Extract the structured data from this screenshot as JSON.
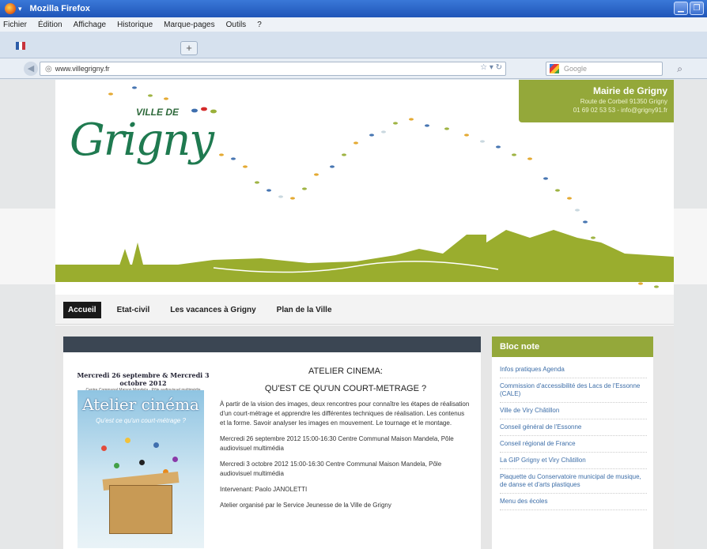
{
  "window": {
    "title": "Mozilla Firefox",
    "menu": [
      "Fichier",
      "Édition",
      "Affichage",
      "Historique",
      "Marque-pages",
      "Outils",
      "?"
    ],
    "tab_label": "",
    "new_tab_label": "+",
    "url": "www.villegrigny.fr",
    "search_placeholder": "Google",
    "colors": {
      "titlebar": "#1f55b8",
      "accent": "#94a83a"
    }
  },
  "site": {
    "logo": {
      "prefix": "VILLE DE",
      "name": "Grigny"
    },
    "mairie": {
      "title": "Mairie de Grigny",
      "line1": "Route de Corbeil 91350 Grigny",
      "line2": "01 69 02 53 53 - info@grigny91.fr"
    },
    "nav": [
      {
        "label": "Accueil",
        "active": true
      },
      {
        "label": "Etat-civil",
        "active": false
      },
      {
        "label": "Les vacances à Grigny",
        "active": false
      },
      {
        "label": "Plan de la Ville",
        "active": false
      }
    ],
    "article": {
      "poster_header": "Mercredi 26 septembre & Mercredi 3 octobre 2012",
      "poster_sub": "Centre Communal Maison Mandela · Pôle audiovisuel multimédia",
      "poster_title": "Atelier cinéma",
      "poster_script": "Qu'est ce qu'un court-métrage ?",
      "heading": "ATELIER CINEMA:",
      "subheading": "QU'EST CE QU'UN COURT-METRAGE ?",
      "paragraphs": [
        "À partir de la vision des images, deux rencontres pour connaître les étapes de réalisation d'un court-métrage et apprendre les différentes techniques de réalisation. Les contenus et la forme. Savoir analyser les images en mouvement. Le tournage et le montage.",
        "Mercredi 26 septembre 2012 15:00-16:30 Centre Communal Maison Mandela, Pôle audiovisuel multimédia",
        "Mercredi 3 octobre 2012 15:00-16:30 Centre Communal Maison Mandela, Pôle audiovisuel multimédia",
        "Intervenant: Paolo JANOLETTI",
        "Atelier organisé par le Service Jeunesse de la Ville de Grigny"
      ]
    },
    "sidebar": {
      "title": "Bloc note",
      "links": [
        "Infos pratiques Agenda",
        "Commission d'accessibilité des Lacs de l'Essonne (CALE)",
        "Ville de Viry Châtillon",
        "Conseil général de l'Essonne",
        "Conseil régional de France",
        "La GIP Grigny et Viry Châtillon",
        "Plaquette du Conservatoire municipal de musique, de danse et d'arts plastiques",
        "Menu des écoles"
      ]
    }
  }
}
